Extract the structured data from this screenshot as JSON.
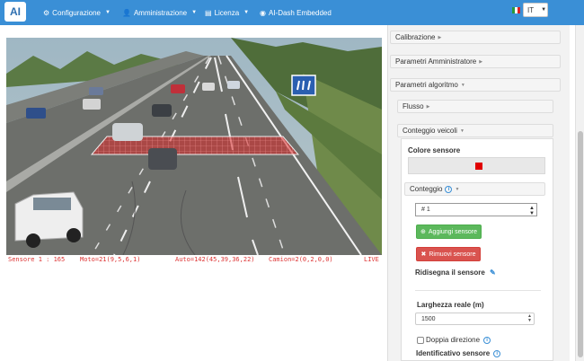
{
  "navbar": {
    "logo": "AI",
    "items": [
      {
        "label": "Configurazione",
        "icon": "gear-icon"
      },
      {
        "label": "Amministrazione",
        "icon": "user-icon"
      },
      {
        "label": "Licenza",
        "icon": "license-icon"
      },
      {
        "label": "AI-Dash Embedded",
        "icon": "dashboard-icon"
      }
    ],
    "language": "IT"
  },
  "video": {
    "overlay": {
      "sensor": "Sensore 1 : 165",
      "moto": "Moto=21(9,5,6,1)",
      "auto": "Auto=142(45,39,36,22)",
      "camion": "Camion=2(0,2,0,0)",
      "status": "LIVE"
    }
  },
  "panel": {
    "calibrazione": "Calibrazione",
    "parametri_admin": "Parametri Amministratore",
    "parametri_algoritmo": "Parametri algoritmo",
    "flusso": "Flusso",
    "conteggio_veicoli": "Conteggio veicoli",
    "colore_sensore": "Colore sensore",
    "sensor_color": "#e00000",
    "conteggio": "Conteggio",
    "selected_sensor": "# 1",
    "add_sensor": "Aggiungi sensore",
    "remove_sensor": "Rimuovi sensore",
    "redraw_sensor": "Ridisegna il sensore",
    "larghezza_label": "Larghezza reale (m)",
    "larghezza_value": "1500",
    "doppia_direzione": "Doppia direzione",
    "identificativo": "Identificativo sensore"
  },
  "colors": {
    "navbar": "#3a8fd6",
    "overlay_text": "#dd3333",
    "add_button": "#5cb85c",
    "remove_button": "#d9534f"
  }
}
